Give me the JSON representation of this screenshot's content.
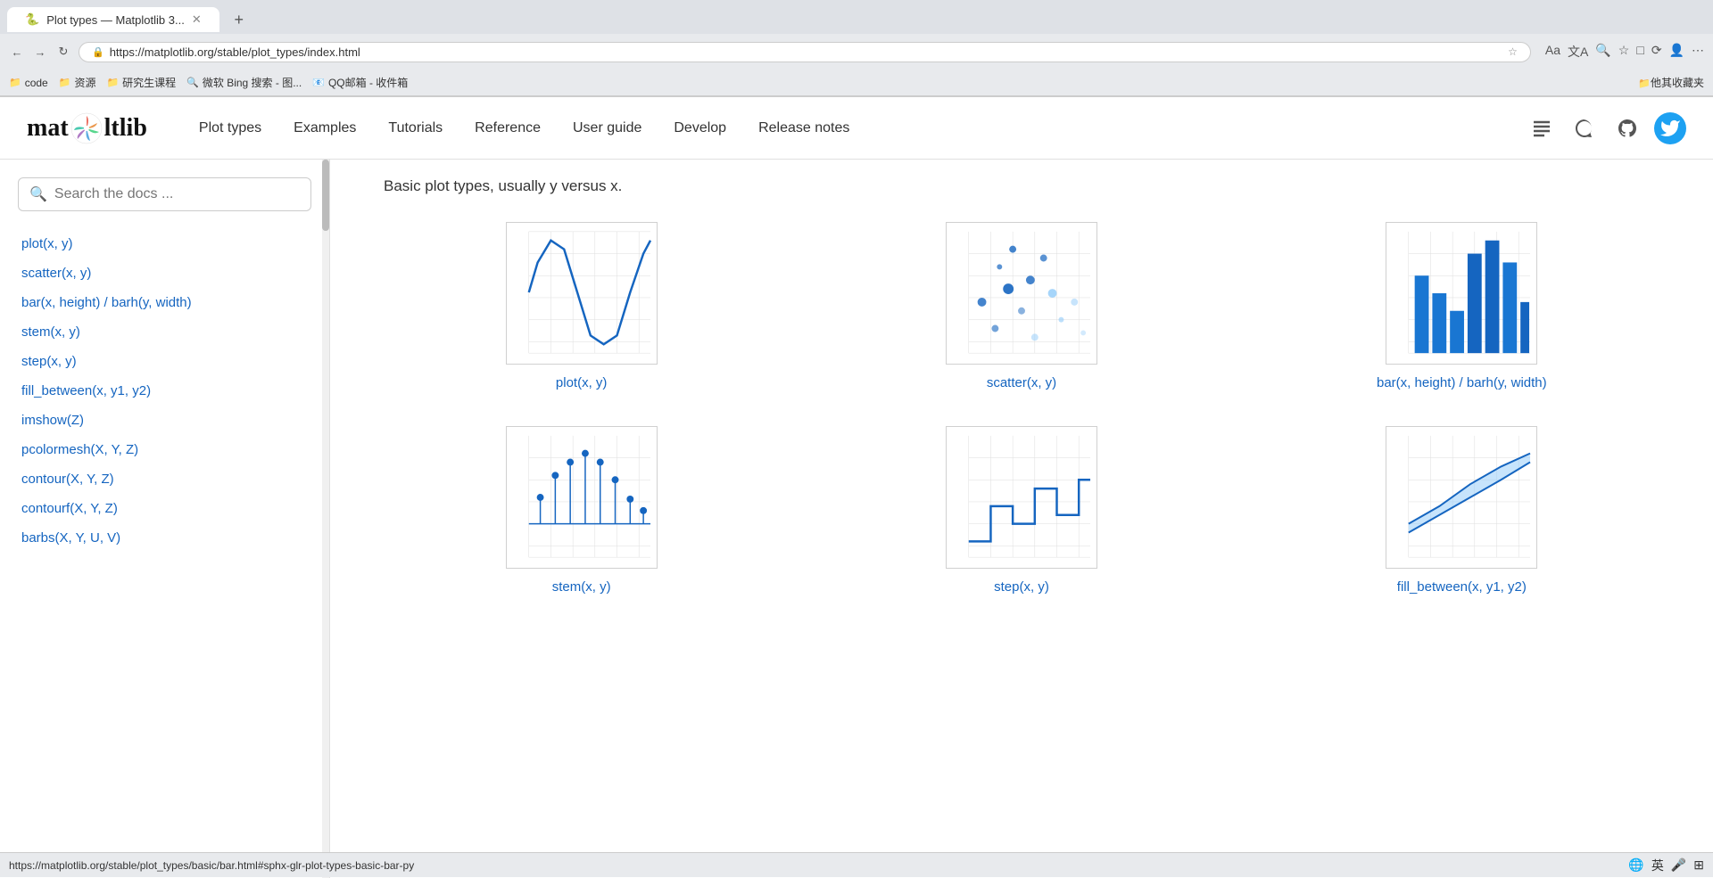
{
  "browser": {
    "url": "https://matplotlib.org/stable/plot_types/index.html",
    "bookmarks": [
      {
        "label": "code",
        "icon": "📁"
      },
      {
        "label": "资源",
        "icon": "📁"
      },
      {
        "label": "研究生课程",
        "icon": "📁"
      },
      {
        "label": "微软 Bing 搜索 - 图...",
        "icon": "🔍"
      },
      {
        "label": "QQ邮箱 - 收件箱",
        "icon": "📧"
      },
      {
        "label": "他其收藏夹",
        "icon": "📁"
      }
    ]
  },
  "header": {
    "logo_text_left": "mat",
    "logo_text_right": "ltlib",
    "nav_items": [
      {
        "label": "Plot types",
        "href": "#"
      },
      {
        "label": "Examples",
        "href": "#"
      },
      {
        "label": "Tutorials",
        "href": "#"
      },
      {
        "label": "Reference",
        "href": "#"
      },
      {
        "label": "User guide",
        "href": "#"
      },
      {
        "label": "Develop",
        "href": "#"
      },
      {
        "label": "Release notes",
        "href": "#"
      }
    ]
  },
  "sidebar": {
    "search_placeholder": "Search the docs ...",
    "links": [
      "plot(x, y)",
      "scatter(x, y)",
      "bar(x, height) / barh(y, width)",
      "stem(x, y)",
      "step(x, y)",
      "fill_between(x, y1, y2)",
      "imshow(Z)",
      "pcolormesh(X, Y, Z)",
      "contour(X, Y, Z)",
      "contourf(X, Y, Z)",
      "barbs(X, Y, U, V)"
    ]
  },
  "main": {
    "section_description": "Basic plot types, usually y versus x.",
    "plots": [
      {
        "label": "plot(x, y)",
        "type": "line"
      },
      {
        "label": "scatter(x, y)",
        "type": "scatter"
      },
      {
        "label": "bar(x, height) / barh(y,\nwidth)",
        "type": "bar"
      },
      {
        "label": "stem(x, y)",
        "type": "stem"
      },
      {
        "label": "step(x, y)",
        "type": "step"
      },
      {
        "label": "fill_between(x, y1, y2)",
        "type": "fill_between"
      }
    ]
  },
  "status_bar": {
    "url": "https://matplotlib.org/stable/plot_types/basic/bar.html#sphx-glr-plot-types-basic-bar-py"
  }
}
